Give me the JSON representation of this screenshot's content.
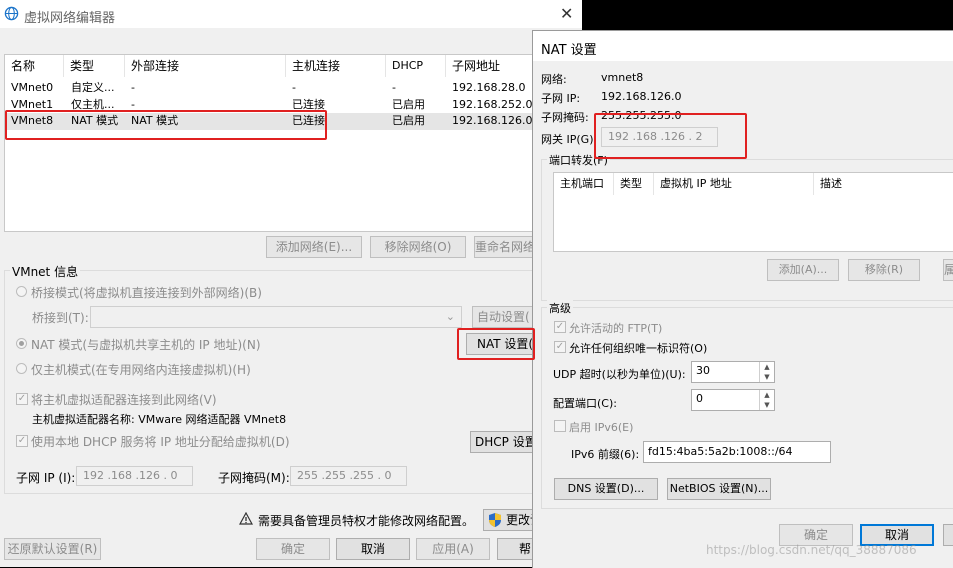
{
  "left": {
    "title": "虚拟网络编辑器",
    "columns": [
      "名称",
      "类型",
      "外部连接",
      "主机连接",
      "DHCP",
      "子网地址"
    ],
    "rows": [
      [
        "VMnet0",
        "自定义...",
        "-",
        "-",
        "-",
        "192.168.28.0"
      ],
      [
        "VMnet1",
        "仅主机...",
        "-",
        "已连接",
        "已启用",
        "192.168.252.0"
      ],
      [
        "VMnet8",
        "NAT 模式",
        "NAT 模式",
        "已连接",
        "已启用",
        "192.168.126.0"
      ]
    ],
    "add_network": "添加网络(E)...",
    "remove_network": "移除网络(O)",
    "rename_network": "重命名网络",
    "vmnet_info": "VMnet 信息",
    "bridged_mode": "桥接模式(将虚拟机直接连接到外部网络)(B)",
    "bridged_to": "桥接到(T):",
    "auto_settings": "自动设置(",
    "nat_mode": "NAT 模式(与虚拟机共享主机的 IP 地址)(N)",
    "nat_settings": "NAT 设置(",
    "host_only": "仅主机模式(在专用网络内连接虚拟机)(H)",
    "connect_adapter": "将主机虚拟适配器连接到此网络(V)",
    "adapter_name": "主机虚拟适配器名称: VMware 网络适配器 VMnet8",
    "use_dhcp": "使用本地 DHCP 服务将 IP 地址分配给虚拟机(D)",
    "dhcp_settings": "DHCP 设置(",
    "subnet_ip_label": "子网 IP (I):",
    "subnet_ip": "192 .168 .126 . 0",
    "subnet_mask_label": "子网掩码(M):",
    "subnet_mask": "255 .255 .255 . 0",
    "admin_notice": "需要具备管理员特权才能修改网络配置。",
    "change_settings": "更改设",
    "restore_defaults": "还原默认设置(R)",
    "ok": "确定",
    "cancel": "取消",
    "apply": "应用(A)",
    "help": "帮"
  },
  "nat": {
    "title": "NAT 设置",
    "network_label": "网络:",
    "network": "vmnet8",
    "subnet_ip_label": "子网 IP:",
    "subnet_ip": "192.168.126.0",
    "subnet_mask_label": "子网掩码:",
    "subnet_mask": "255.255.255.0",
    "gateway_label": "网关 IP(G):",
    "gateway": "192 .168 .126 . 2",
    "port_forwarding": "端口转发(F)",
    "pf_columns": [
      "主机端口",
      "类型",
      "虚拟机 IP 地址",
      "描述"
    ],
    "pf_add": "添加(A)...",
    "pf_remove": "移除(R)",
    "pf_props": "属",
    "advanced": "高级",
    "allow_ftp": "允许活动的 FTP(T)",
    "allow_oui": "允许任何组织唯一标识符(O)",
    "udp_timeout_label": "UDP 超时(以秒为单位)(U):",
    "udp_timeout": "30",
    "config_port_label": "配置端口(C):",
    "config_port": "0",
    "enable_ipv6": "启用 IPv6(E)",
    "ipv6_prefix_label": "IPv6 前缀(6):",
    "ipv6_prefix": "fd15:4ba5:5a2b:1008::/64",
    "dns_settings": "DNS 设置(D)...",
    "netbios_settings": "NetBIOS 设置(N)...",
    "ok": "确定",
    "cancel": "取消"
  },
  "watermark": "https://blog.csdn.net/qq_38887086"
}
